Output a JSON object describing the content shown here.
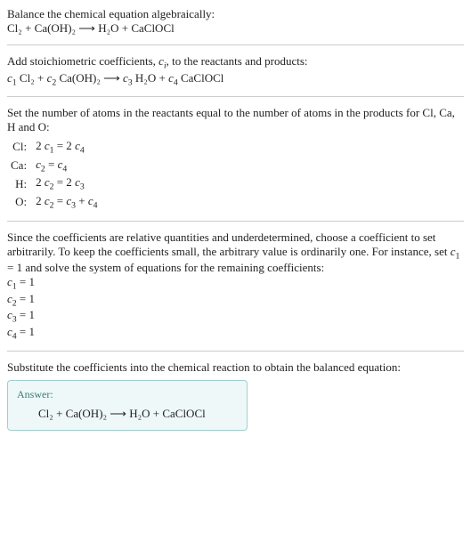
{
  "s1": {
    "line1": "Balance the chemical equation algebraically:",
    "eq": "Cl₂ + Ca(OH)₂ ⟶ H₂O + CaClOCl"
  },
  "s2": {
    "line1_pre": "Add stoichiometric coefficients, ",
    "line1_ci": "c",
    "line1_i": "i",
    "line1_post": ", to the reactants and products:",
    "eq_c1": "c",
    "eq_c1i": "1",
    "eq_t1": " Cl₂ + ",
    "eq_c2": "c",
    "eq_c2i": "2",
    "eq_t2": " Ca(OH)₂ ⟶ ",
    "eq_c3": "c",
    "eq_c3i": "3",
    "eq_t3": " H₂O + ",
    "eq_c4": "c",
    "eq_c4i": "4",
    "eq_t4": " CaClOCl"
  },
  "s3": {
    "line1": "Set the number of atoms in the reactants equal to the number of atoms in the products for Cl, Ca, H and O:",
    "rows": {
      "0": {
        "el": "Cl:",
        "t0": "2 ",
        "c0": "c",
        "i0": "1",
        "mid": " = 2 ",
        "c1": "c",
        "i1": "4",
        "tail": ""
      },
      "1": {
        "el": "Ca:",
        "t0": "",
        "c0": "c",
        "i0": "2",
        "mid": " = ",
        "c1": "c",
        "i1": "4",
        "tail": ""
      },
      "2": {
        "el": "H:",
        "t0": "2 ",
        "c0": "c",
        "i0": "2",
        "mid": " = 2 ",
        "c1": "c",
        "i1": "3",
        "tail": ""
      },
      "3": {
        "el": "O:",
        "t0": "2 ",
        "c0": "c",
        "i0": "2",
        "mid": " = ",
        "c1": "c",
        "i1": "3",
        "tail_plus": " + ",
        "c2": "c",
        "i2": "4"
      }
    }
  },
  "s4": {
    "line1_pre": "Since the coefficients are relative quantities and underdetermined, choose a coefficient to set arbitrarily. To keep the coefficients small, the arbitrary value is ordinarily one. For instance, set ",
    "line1_c": "c",
    "line1_ci": "1",
    "line1_post": " = 1 and solve the system of equations for the remaining coefficients:",
    "rows": {
      "0": {
        "c": "c",
        "i": "1",
        "v": " = 1"
      },
      "1": {
        "c": "c",
        "i": "2",
        "v": " = 1"
      },
      "2": {
        "c": "c",
        "i": "3",
        "v": " = 1"
      },
      "3": {
        "c": "c",
        "i": "4",
        "v": " = 1"
      }
    }
  },
  "s5": {
    "line1": "Substitute the coefficients into the chemical reaction to obtain the balanced equation:",
    "answer_label": "Answer:",
    "answer_eq": "Cl₂ + Ca(OH)₂ ⟶ H₂O + CaClOCl"
  }
}
